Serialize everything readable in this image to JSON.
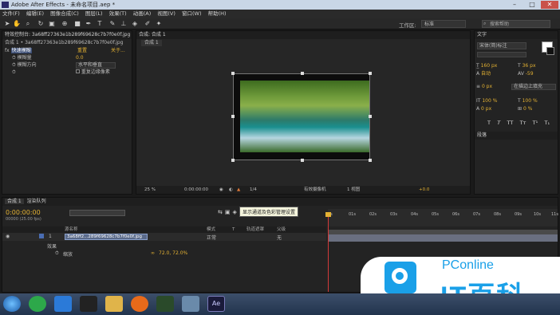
{
  "window": {
    "title": "Adobe After Effects - 未命名项目.aep *"
  },
  "menu": [
    "文件(F)",
    "编辑(E)",
    "图像合成(C)",
    "图层(L)",
    "效果(T)",
    "动画(A)",
    "视图(V)",
    "窗口(W)",
    "帮助(H)"
  ],
  "toolbar": {
    "workspace_label": "工作区:",
    "workspace_value": "标准",
    "search_placeholder": "搜索帮助"
  },
  "effects_panel": {
    "tab_label": "特效控制台: 3a68ff27363e1b289f69628c7b7f0e0f.jpg",
    "subtitle": "合成 1 • 3a68ff27363e1b289f69628c7b7f0e0f.jpg",
    "effect_name": "快速模糊",
    "reset_label": "重置",
    "about_label": "关于...",
    "properties": [
      {
        "name": "模糊量",
        "value": "0.0"
      },
      {
        "name": "模糊方向",
        "value": "水平和垂直"
      },
      {
        "name": "",
        "value": "重复边缘像素"
      }
    ]
  },
  "comp_panel": {
    "tab_label": "合成: 合成 1",
    "sub_tab": "合成 1",
    "zoom": "25 %",
    "timecode": "0:00:00:00",
    "resolution": "1/4",
    "camera": "有效摄像机",
    "views": "1 视图",
    "exposure": "+0.0",
    "tooltip": "显示通道及色彩管理设置"
  },
  "text_panel": {
    "tab_label": "文字",
    "font": "宋体(简)标注",
    "size": "36 px",
    "leading": "自动",
    "kerning": "160 px",
    "tracking": "-59",
    "stroke_width": "0 px",
    "stroke_mode": "在描边上填充",
    "vscale": "100 %",
    "hscale": "100 %",
    "baseline": "0 px",
    "tsume": "0 %",
    "style_buttons": [
      "T",
      "T",
      "TT",
      "Tт",
      "T¹",
      "T₁"
    ]
  },
  "paragraph_panel": {
    "tab_label": "段落"
  },
  "timeline": {
    "tabs": [
      "合成 1",
      "渲染队列"
    ],
    "timecode": "0:00:00:00",
    "frames": "00000 (25.00 fps)",
    "columns": [
      "源名称",
      "模式",
      "T",
      "轨道遮罩",
      "父级"
    ],
    "layer_number": "1",
    "layer_name": "3a68ff2...289f69628c7b7f0e0f.jpg",
    "layer_mode": "正常",
    "layer_parent": "无",
    "effects_label": "效果",
    "scale_label": "缩放",
    "scale_value": "72.0, 72.0%",
    "ruler": [
      "0s",
      "01s",
      "02s",
      "03s",
      "04s",
      "05s",
      "06s",
      "07s",
      "08s",
      "09s",
      "10s",
      "11s"
    ]
  },
  "watermark": {
    "brand": "PConline",
    "slogan": "IT百科"
  },
  "colors": {
    "accent": "#e3b133",
    "blue": "#5f9fe8",
    "bg": "#1a1a1a",
    "panel": "#232323"
  }
}
